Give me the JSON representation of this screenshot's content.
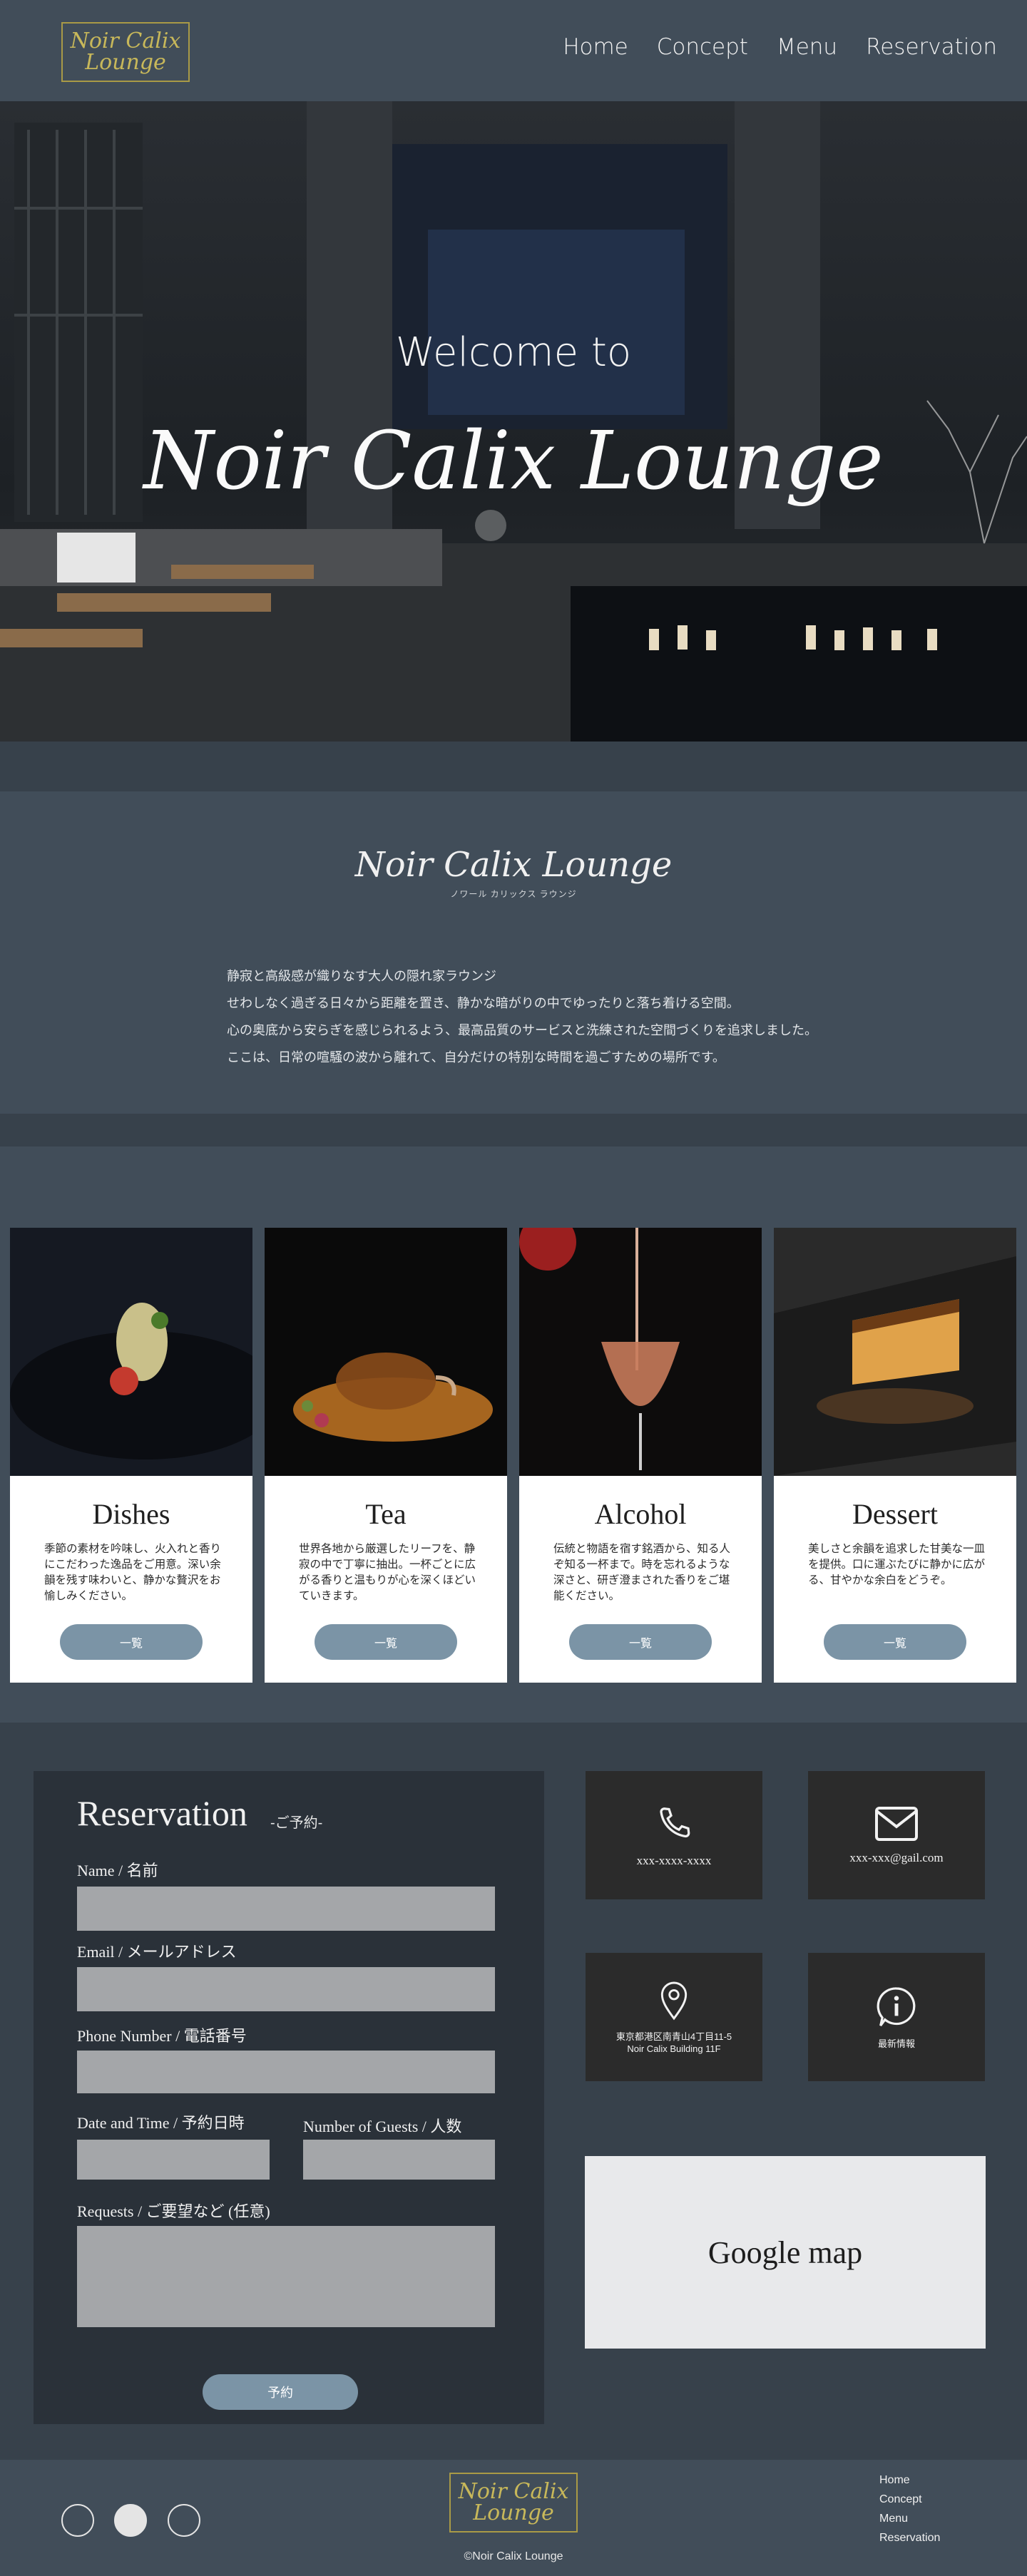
{
  "header": {
    "logo_line1": "Noir Calix",
    "logo_line2": "Lounge",
    "nav": [
      "Home",
      "Concept",
      "Menu",
      "Reservation"
    ]
  },
  "hero": {
    "welcome": "Welcome to",
    "title": "Noir Calix Lounge"
  },
  "concept": {
    "title": "Noir Calix Lounge",
    "subtitle": "ノワール カリックス ラウンジ",
    "lines": [
      "静寂と高級感が織りなす大人の隠れ家ラウンジ",
      "せわしなく過ぎる日々から距離を置き、静かな暗がりの中でゆったりと落ち着ける空間。",
      "心の奥底から安らぎを感じられるよう、最高品質のサービスと洗練された空間づくりを追求しました。",
      "ここは、日常の喧騒の波から離れて、自分だけの特別な時間を過ごすための場所です。"
    ]
  },
  "menu": {
    "cards": [
      {
        "title": "Dishes",
        "desc": "季節の素材を吟味し、火入れと香りにこだわった逸品をご用意。深い余韻を残す味わいと、静かな贅沢をお愉しみください。",
        "button": "一覧"
      },
      {
        "title": "Tea",
        "desc": "世界各地から厳選したリーフを、静寂の中で丁寧に抽出。一杯ごとに広がる香りと温もりが心を深くほどいていきます。",
        "button": "一覧"
      },
      {
        "title": "Alcohol",
        "desc": "伝統と物語を宿す銘酒から、知る人ぞ知る一杯まで。時を忘れるような深さと、研ぎ澄まされた香りをご堪能ください。",
        "button": "一覧"
      },
      {
        "title": "Dessert",
        "desc": "美しさと余韻を追求した甘美な一皿を提供。口に運ぶたびに静かに広がる、甘やかな余白をどうぞ。",
        "button": "一覧"
      }
    ]
  },
  "reservation": {
    "title": "Reservation",
    "subtitle": "-ご予約-",
    "name_label": "Name / 名前",
    "email_label": "Email / メールアドレス",
    "phone_label": "Phone Number / 電話番号",
    "date_label": "Date and Time / 予約日時",
    "guests_label": "Number of Guests / 人数",
    "requests_label": "Requests / ご要望など (任意)",
    "submit": "予約"
  },
  "contact": {
    "phone": "xxx-xxxx-xxxx",
    "email": "xxx-xxx@gail.com",
    "address_line1": "東京都港区南青山4丁目11-5",
    "address_line2": "Noir Calix Building 11F",
    "news": "最新情報",
    "map": "Google map"
  },
  "footer": {
    "logo_line1": "Noir Calix",
    "logo_line2": "Lounge",
    "copyright": "©Noir Calix Lounge",
    "links": [
      "Home",
      "Concept",
      "Menu",
      "Reservation"
    ]
  },
  "colors": {
    "header_bg": "#414d59",
    "page_bg": "#37414b",
    "gold": "#a99a46",
    "button": "#7b94a6",
    "tile_bg": "#2b2b2b"
  }
}
